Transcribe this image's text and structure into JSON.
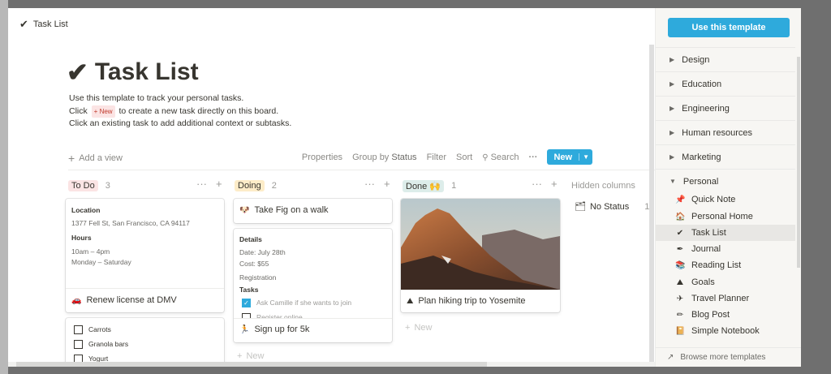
{
  "breadcrumb": {
    "icon": "checkmark-icon",
    "label": "Task List"
  },
  "page": {
    "title": "Task List",
    "desc_line1": "Use this template to track your personal tasks.",
    "desc_line2_a": "Click",
    "desc_line2_chip": "+ New",
    "desc_line2_b": "to create a new task directly on this board.",
    "desc_line3": "Click an existing task to add additional context or subtasks."
  },
  "toolbar": {
    "add_view": "Add a view",
    "properties": "Properties",
    "group_by_prefix": "Group by",
    "group_by_value": "Status",
    "filter": "Filter",
    "sort": "Sort",
    "search": "Search",
    "more": "···",
    "new": "New"
  },
  "columns": {
    "todo": {
      "label": "To Do",
      "count": "3",
      "color": "#fbe4e4"
    },
    "doing": {
      "label": "Doing",
      "count": "2",
      "color": "#fdecc8"
    },
    "done": {
      "label": "Done 🙌",
      "count": "1",
      "color": "#ddedea"
    },
    "hidden": {
      "label": "Hidden columns",
      "no_status": "No Status",
      "no_status_count": "1"
    }
  },
  "cards": {
    "dmv": {
      "location_label": "Location",
      "location": "1377 Fell St, San Francisco, CA 94117",
      "hours_label": "Hours",
      "hours1": "10am – 4pm",
      "hours2": "Monday – Saturday",
      "icon": "🚗",
      "title": "Renew license at DMV"
    },
    "groceries": {
      "items": [
        "Carrots",
        "Granola bars",
        "Yogurt"
      ]
    },
    "fig": {
      "icon": "🐶",
      "title": "Take Fig on a walk"
    },
    "fivek": {
      "details_label": "Details",
      "date": "Date: July 28th",
      "cost": "Cost: $55",
      "registration": "Registration",
      "tasks": "Tasks",
      "task1": "Ask Camille if she wants to join",
      "task2": "Register online",
      "icon": "🏃",
      "title": "Sign up for 5k"
    },
    "hike": {
      "icon": "⛰",
      "title": "Plan hiking trip to Yosemite"
    }
  },
  "add_new": "New",
  "sidebar": {
    "use_template": "Use this template",
    "categories": [
      "Design",
      "Education",
      "Engineering",
      "Human resources",
      "Marketing",
      "Personal"
    ],
    "personal_items": [
      {
        "icon": "📌",
        "label": "Quick Note"
      },
      {
        "icon": "🏠",
        "label": "Personal Home"
      },
      {
        "icon": "✔",
        "label": "Task List"
      },
      {
        "icon": "✒",
        "label": "Journal"
      },
      {
        "icon": "📚",
        "label": "Reading List"
      },
      {
        "icon": "⛰",
        "label": "Goals"
      },
      {
        "icon": "✈",
        "label": "Travel Planner"
      },
      {
        "icon": "✏",
        "label": "Blog Post"
      },
      {
        "icon": "📔",
        "label": "Simple Notebook"
      }
    ],
    "browse_more": "Browse more templates"
  }
}
